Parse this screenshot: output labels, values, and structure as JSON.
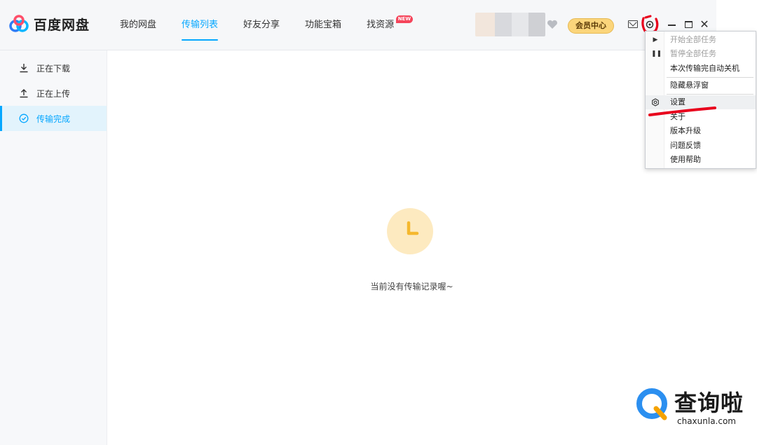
{
  "app": {
    "logo_text": "百度网盘",
    "colors": {
      "accent": "#06a7ff",
      "vip": "#fbd57b",
      "empty_icon": "#fdeac0",
      "annotation": "#e8001c"
    }
  },
  "nav": {
    "tabs": [
      {
        "label": "我的网盘"
      },
      {
        "label": "传输列表",
        "active": true
      },
      {
        "label": "好友分享"
      },
      {
        "label": "功能宝箱"
      },
      {
        "label": "找资源",
        "badge": "NEW"
      }
    ]
  },
  "header": {
    "vip_label": "会员中心",
    "icons": [
      "heart-icon",
      "mail-icon",
      "gear-icon",
      "minimize-icon",
      "maximize-icon",
      "close-icon"
    ]
  },
  "sidebar": {
    "items": [
      {
        "label": "正在下载",
        "icon": "download-icon"
      },
      {
        "label": "正在上传",
        "icon": "upload-icon"
      },
      {
        "label": "传输完成",
        "icon": "check-circle-icon",
        "active": true
      }
    ]
  },
  "main": {
    "empty_text": "当前没有传输记录喔~",
    "empty_icon": "clock-icon"
  },
  "menu": {
    "items": [
      {
        "label": "开始全部任务",
        "disabled": true,
        "icon": "play-icon"
      },
      {
        "label": "暂停全部任务",
        "disabled": true,
        "icon": "pause-icon"
      },
      {
        "label": "本次传输完自动关机"
      },
      {
        "label": "隐藏悬浮窗"
      },
      {
        "label": "设置",
        "icon": "settings-icon",
        "hover": true
      },
      {
        "label": "关于"
      },
      {
        "label": "版本升级"
      },
      {
        "label": "问题反馈"
      },
      {
        "label": "使用帮助"
      }
    ]
  },
  "watermark": {
    "title": "查询啦",
    "site": "chaxunla.com"
  }
}
